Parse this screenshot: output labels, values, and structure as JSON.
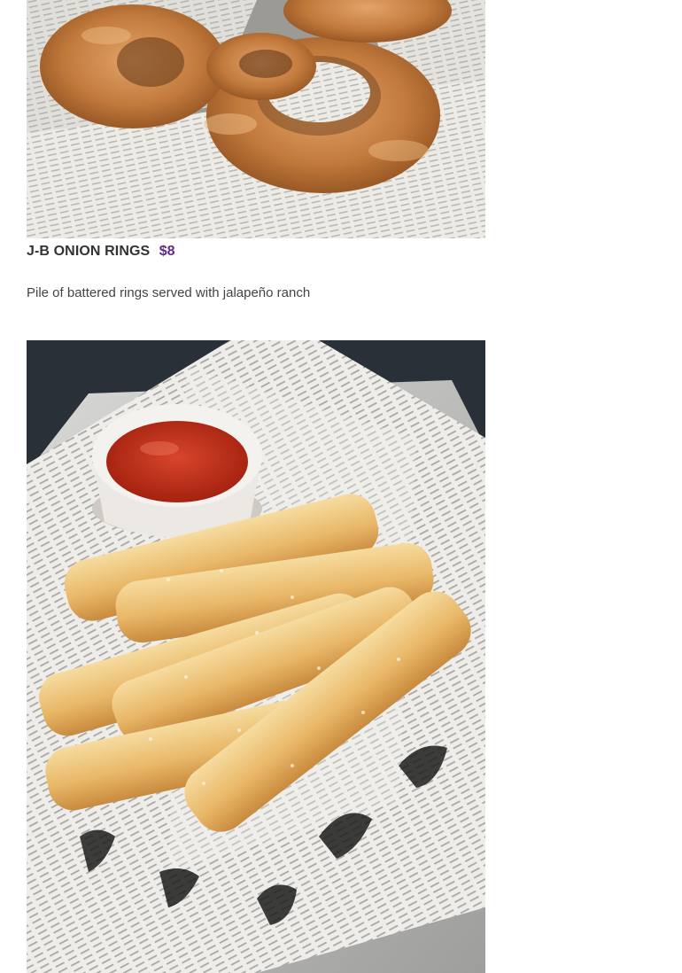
{
  "items": [
    {
      "name": "J-B ONION RINGS",
      "price": "$8",
      "description": "Pile of battered rings served with jalapeño ranch",
      "photo": "onion-rings-photo"
    },
    {
      "photo": "breadsticks-photo"
    }
  ],
  "colors": {
    "price": "#5b2c86",
    "text": "#333333",
    "background": "#ffffff"
  }
}
